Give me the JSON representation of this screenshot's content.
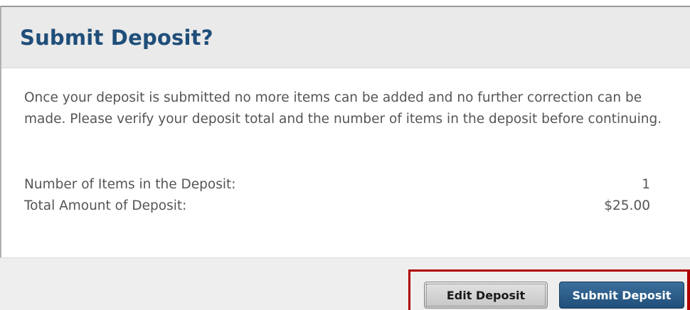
{
  "dialog": {
    "title": "Submit Deposit?",
    "message": "Once your deposit is submitted no more items can be added and no further correction can be made. Please verify your deposit total and the number of items in the deposit before continuing.",
    "summary": [
      {
        "label": "Number of Items in the Deposit:",
        "value": "1"
      },
      {
        "label": "Total Amount of Deposit:",
        "value": "$25.00"
      }
    ],
    "buttons": {
      "edit_label": "Edit Deposit",
      "submit_label": "Submit Deposit"
    }
  },
  "colors": {
    "title": "#1f4e79",
    "primary_button": "#1f4e79",
    "highlight_border": "#b00000"
  }
}
